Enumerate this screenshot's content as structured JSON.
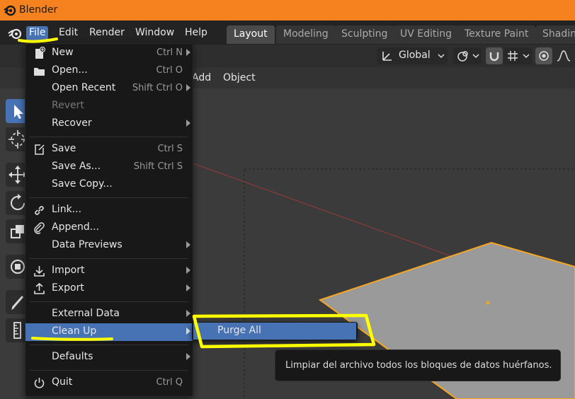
{
  "app": {
    "title": "Blender"
  },
  "menubar": {
    "items": [
      "File",
      "Edit",
      "Render",
      "Window",
      "Help"
    ],
    "active": "File"
  },
  "workspaces": {
    "tabs": [
      "Layout",
      "Modeling",
      "Sculpting",
      "UV Editing",
      "Texture Paint",
      "Shading"
    ],
    "active": "Layout"
  },
  "toolbar": {
    "orientation": "Global"
  },
  "viewport_header": {
    "items": [
      "Add",
      "Object"
    ]
  },
  "file_menu": {
    "new": {
      "label": "New",
      "shortcut": "Ctrl N"
    },
    "open": {
      "label": "Open...",
      "shortcut": "Ctrl O"
    },
    "open_recent": {
      "label": "Open Recent",
      "shortcut": "Shift Ctrl O"
    },
    "revert": {
      "label": "Revert"
    },
    "recover": {
      "label": "Recover"
    },
    "save": {
      "label": "Save",
      "shortcut": "Ctrl S"
    },
    "save_as": {
      "label": "Save As...",
      "shortcut": "Shift Ctrl S"
    },
    "save_copy": {
      "label": "Save Copy..."
    },
    "link": {
      "label": "Link..."
    },
    "append": {
      "label": "Append..."
    },
    "data_previews": {
      "label": "Data Previews"
    },
    "import": {
      "label": "Import"
    },
    "export": {
      "label": "Export"
    },
    "external_data": {
      "label": "External Data"
    },
    "clean_up": {
      "label": "Clean Up"
    },
    "defaults": {
      "label": "Defaults"
    },
    "quit": {
      "label": "Quit",
      "shortcut": "Ctrl Q"
    }
  },
  "clean_up_submenu": {
    "purge_all": "Purge All"
  },
  "tooltip": {
    "text": "Limpiar del archivo todos los bloques de datos huérfanos."
  },
  "colors": {
    "accent": "#4772b3",
    "titlebar": "#f5821f",
    "highlight_annotation": "#ffff00",
    "selection_outline": "#f5a623"
  }
}
